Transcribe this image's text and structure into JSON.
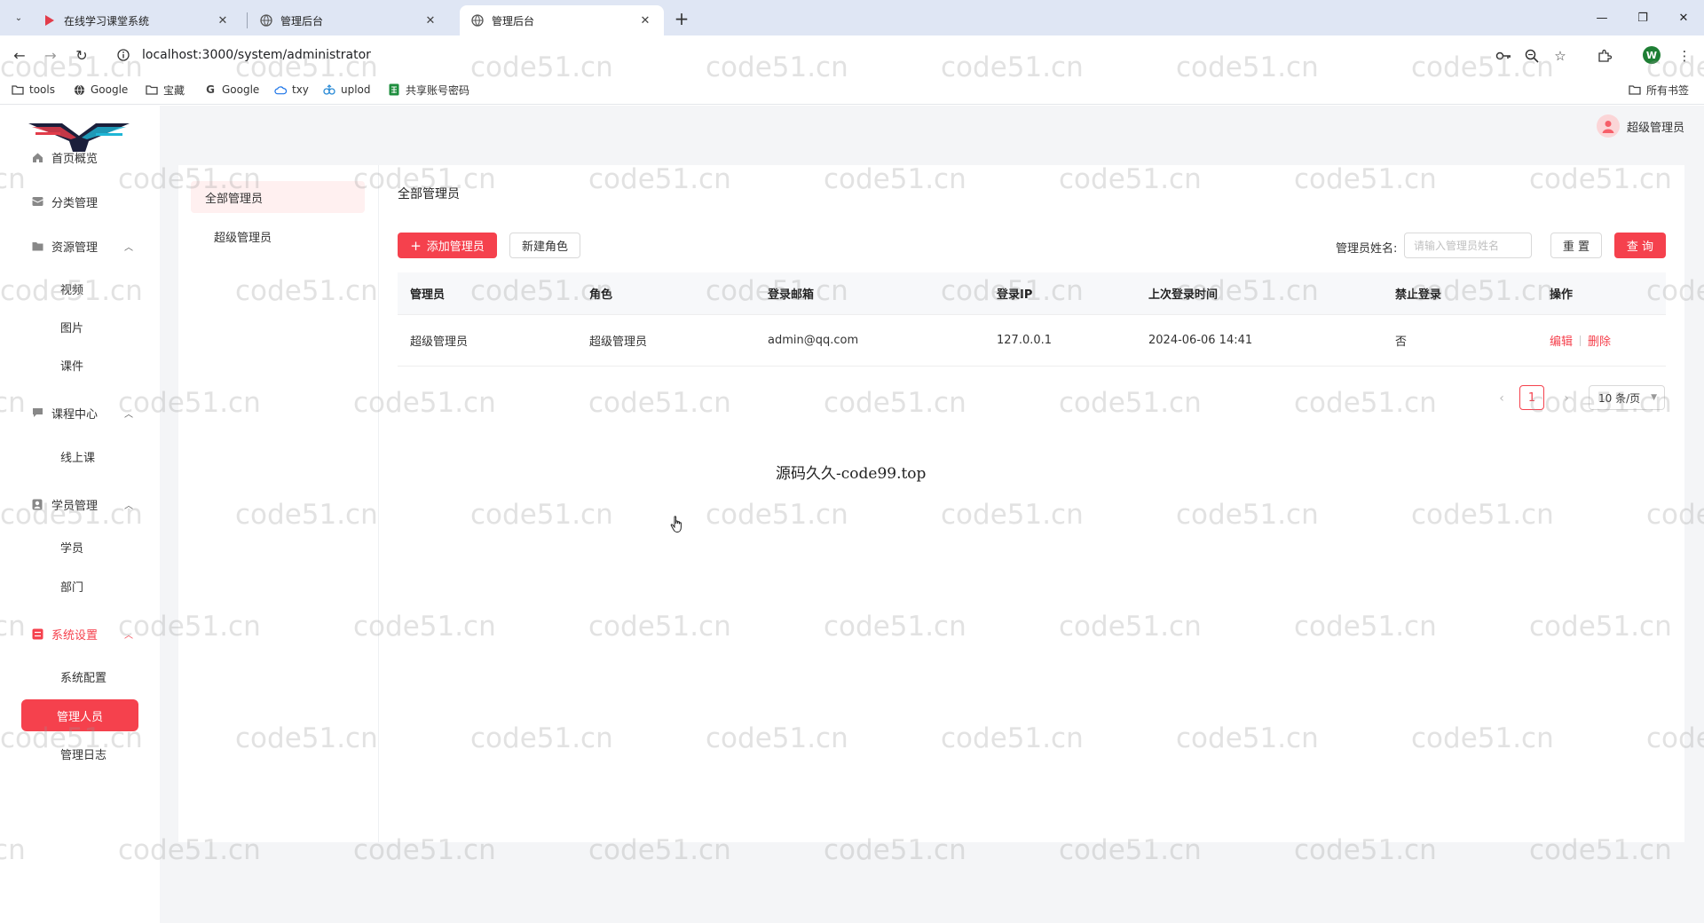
{
  "browser": {
    "tabs": [
      {
        "title": "在线学习课堂系统",
        "active": false
      },
      {
        "title": "管理后台",
        "active": false
      },
      {
        "title": "管理后台",
        "active": true
      }
    ],
    "url": "localhost:3000/system/administrator",
    "profile_initial": "W",
    "bookmarks": [
      {
        "label": "tools",
        "icon": "folder-icon"
      },
      {
        "label": "Google",
        "icon": "globe-icon"
      },
      {
        "label": "宝藏",
        "icon": "folder-icon"
      },
      {
        "label": "Google",
        "icon": "google-icon"
      },
      {
        "label": "txy",
        "icon": "cloud-icon"
      },
      {
        "label": "uplod",
        "icon": "upload-icon"
      },
      {
        "label": "共享账号密码",
        "icon": "sheet-icon"
      }
    ],
    "all_bookmarks": "所有书签"
  },
  "user": {
    "name": "超级管理员"
  },
  "sidebar": {
    "menu": [
      {
        "label": "首页概览",
        "icon": "home-icon"
      },
      {
        "label": "分类管理",
        "icon": "category-icon"
      },
      {
        "label": "资源管理",
        "icon": "folder-icon",
        "expanded": true,
        "children": [
          "视频",
          "图片",
          "课件"
        ]
      },
      {
        "label": "课程中心",
        "icon": "chat-icon",
        "expanded": true,
        "children": [
          "线上课"
        ]
      },
      {
        "label": "学员管理",
        "icon": "user-icon",
        "expanded": true,
        "children": [
          "学员",
          "部门"
        ]
      },
      {
        "label": "系统设置",
        "icon": "settings-icon",
        "expanded": true,
        "active": true,
        "children": [
          "系统配置",
          "管理人员",
          "管理日志"
        ]
      }
    ],
    "active_child": "管理人员"
  },
  "subnav": {
    "items": [
      "全部管理员",
      "超级管理员"
    ],
    "active": "全部管理员"
  },
  "content": {
    "title": "全部管理员",
    "add_button": "添加管理员",
    "new_role_button": "新建角色",
    "filter_label": "管理员姓名:",
    "filter_placeholder": "请输入管理员姓名",
    "reset_button": "重 置",
    "search_button": "查 询"
  },
  "table": {
    "columns": [
      "管理员",
      "角色",
      "登录邮箱",
      "登录IP",
      "上次登录时间",
      "禁止登录",
      "操作"
    ],
    "rows": [
      {
        "name": "超级管理员",
        "role": "超级管理员",
        "email": "admin@qq.com",
        "ip": "127.0.0.1",
        "last_login": "2024-06-06 14:41",
        "banned": "否",
        "edit": "编辑",
        "delete": "删除"
      }
    ]
  },
  "pagination": {
    "current_page": "1",
    "page_size": "10 条/页"
  },
  "source_note": "源码久久-code99.top",
  "watermark": "code51.cn",
  "colors": {
    "accent": "#f5414d",
    "page_bg": "#f4f5f7",
    "tab_strip": "#dfe6f4"
  }
}
